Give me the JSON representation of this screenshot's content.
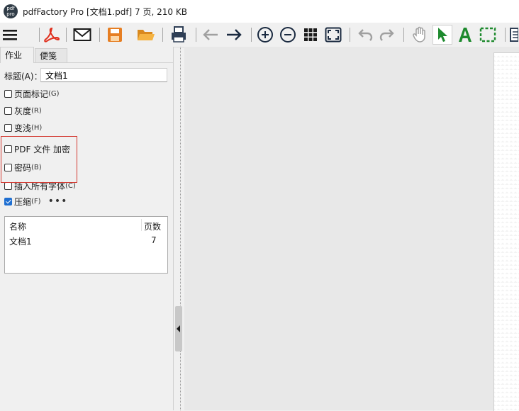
{
  "window": {
    "title": "pdfFactory Pro [文档1.pdf] 7 页, 210 KB",
    "app_icon_text": [
      "pdf",
      "pro"
    ]
  },
  "toolbar": {
    "buttons": [
      "menu-icon",
      "acrobat-icon",
      "email-icon",
      "save-icon",
      "open-folder-icon",
      "print-icon",
      "back-arrow-icon",
      "forward-arrow-icon",
      "zoom-in-icon",
      "zoom-out-icon",
      "grid-icon",
      "fit-page-icon",
      "undo-icon",
      "redo-icon",
      "hand-icon",
      "pointer-icon",
      "text-icon",
      "select-rect-icon",
      "page-icon"
    ],
    "colors": {
      "dark": "#2f3f56",
      "acrobat": "#e0301e",
      "save": "#e67e22",
      "folder": "#f0a030",
      "green": "#1e8a2e",
      "disabled": "#a0a0a0"
    }
  },
  "tabs": [
    {
      "label": "作业",
      "active": true
    },
    {
      "label": "便笺",
      "active": false
    }
  ],
  "job": {
    "title_label": "标题(A)：",
    "title_value": "文档1",
    "options": [
      {
        "label": "页面标记",
        "key": "(G)",
        "checked": false
      },
      {
        "label": "灰度",
        "key": "(R)",
        "checked": false
      },
      {
        "label": "变浅",
        "key": "(H)",
        "checked": false
      },
      {
        "label": "PDF 文件 加密",
        "key": "",
        "checked": false
      },
      {
        "label": "密码",
        "key": "(B)",
        "checked": false
      },
      {
        "label": "插入所有字体",
        "key": "(C)",
        "checked": false
      },
      {
        "label": "压缩",
        "key": "(F)",
        "checked": true
      }
    ],
    "more_label": "•••"
  },
  "doc_list": {
    "headers": [
      "名称",
      "页数"
    ],
    "rows": [
      {
        "name": "文档1",
        "pages": "7"
      }
    ]
  }
}
